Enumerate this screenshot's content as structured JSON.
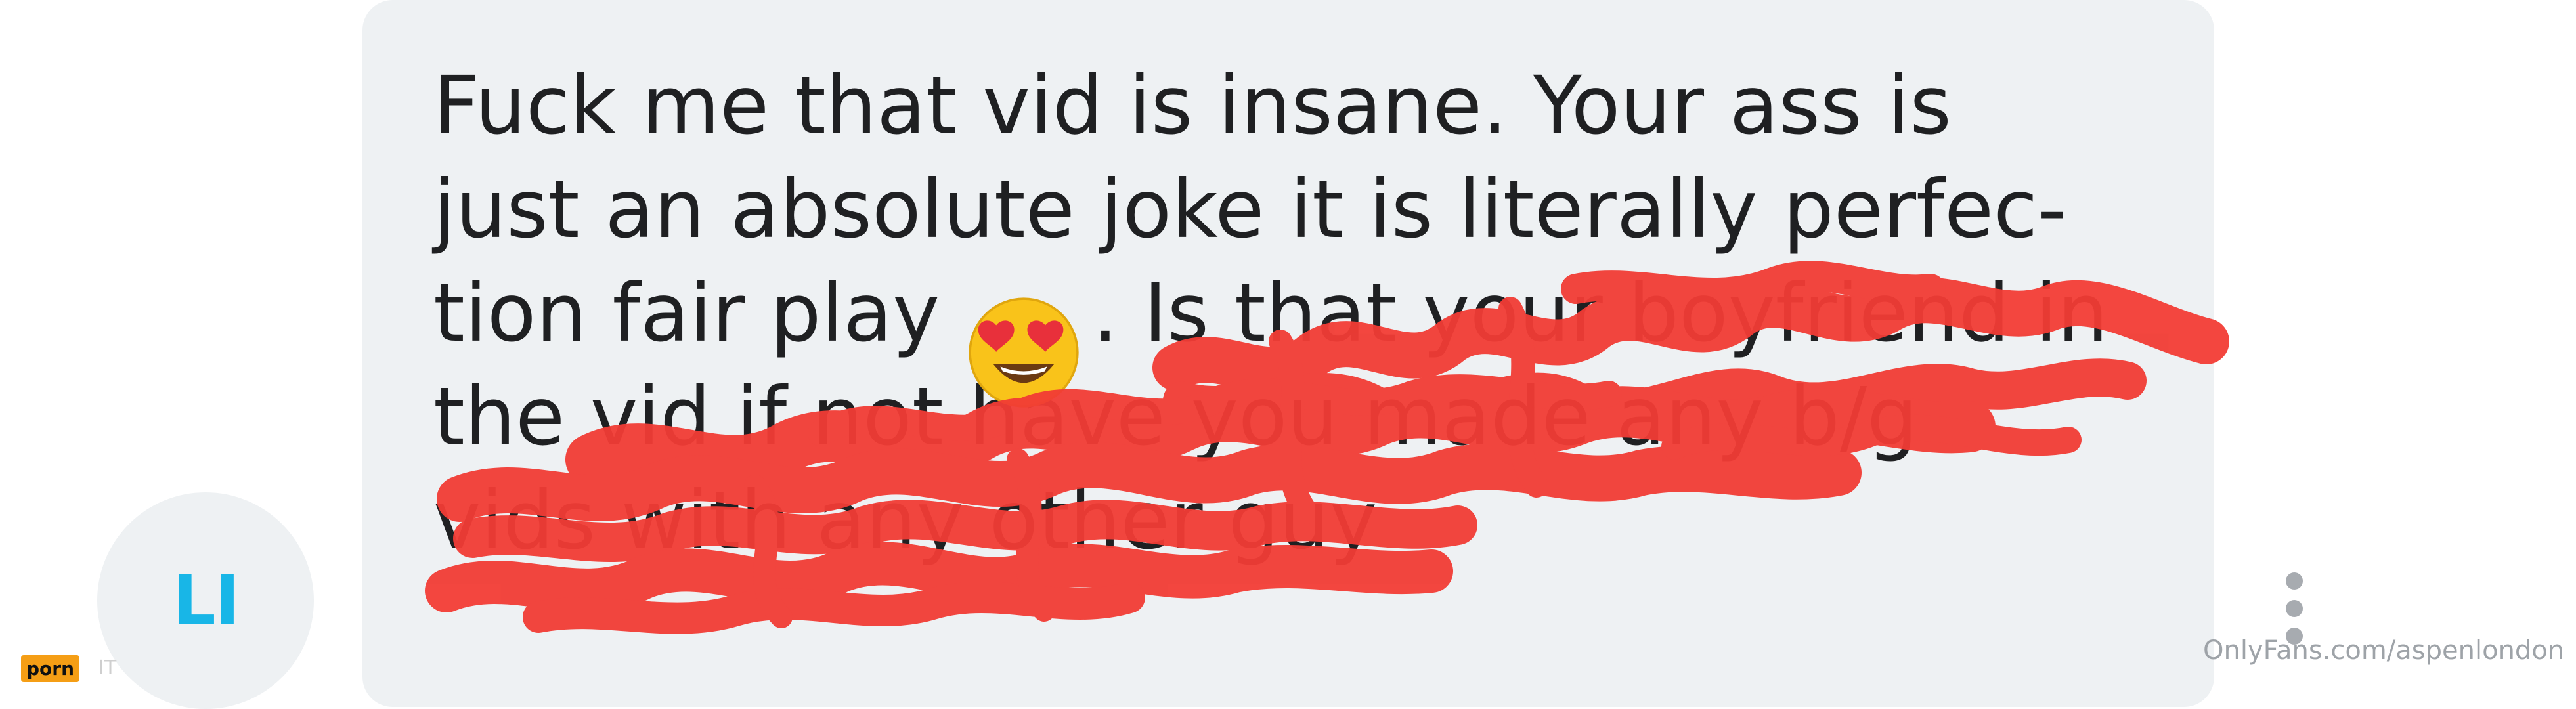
{
  "message": {
    "lines": [
      "Fuck me that vid is insane. Your ass is",
      "just an absolute joke it is literally perfec-",
      "tion fair play      . Is that your boyfriend in",
      "the vid if not have you made any b/g",
      "vids with any other guy"
    ],
    "emoji_icon": "heart-eyes-emoji-icon",
    "redaction_color": "#f23c35"
  },
  "avatar": {
    "initials": "LI",
    "initials_color": "#18b6e7",
    "background": "#eef1f3"
  },
  "more_button": {
    "icon": "vertical-ellipsis-icon"
  },
  "watermark": {
    "text": "OnlyFans.com/aspenlondon"
  },
  "site_logo": {
    "text": "porn",
    "suffix": "IT",
    "color": "#f59e15"
  },
  "colors": {
    "bubble": "#eef1f3",
    "text": "#1f2022",
    "accent": "#18b6e7"
  }
}
